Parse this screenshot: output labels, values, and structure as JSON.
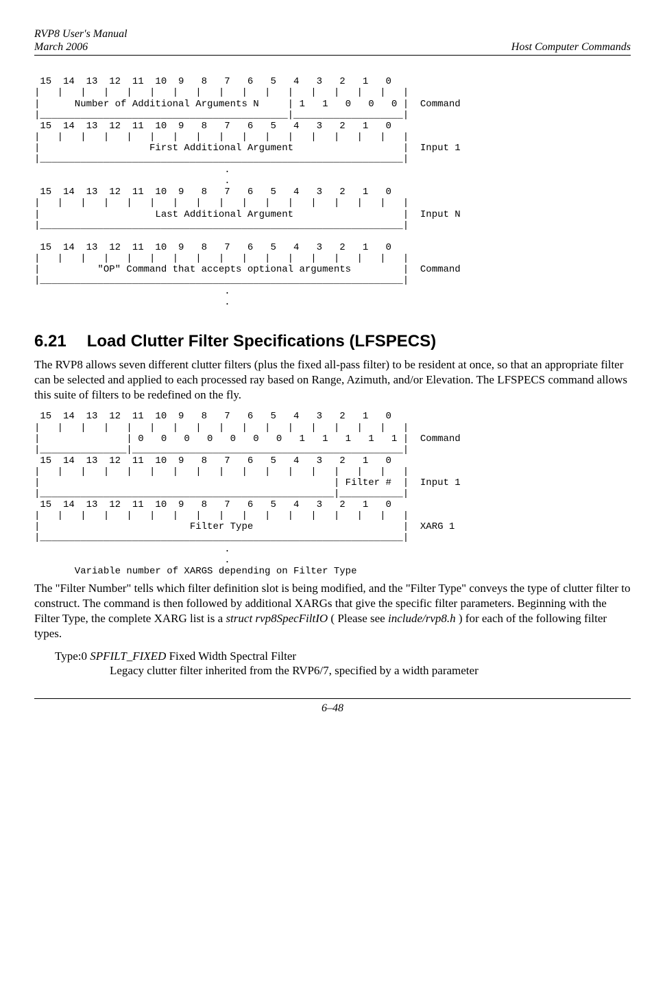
{
  "header": {
    "title": "RVP8 User's Manual",
    "date": "March 2006",
    "right": "Host Computer Commands"
  },
  "diagram1": " 15  14  13  12  11  10  9   8   7   6   5   4   3   2   1   0 \n|   |   |   |   |   |   |   |   |   |   |   |   |   |   |   |   |\n|      Number of Additional Arguments N     | 1   1   0   0   0 |  Command\n|___________________________________________|___________________|\n 15  14  13  12  11  10  9   8   7   6   5   4   3   2   1   0 \n|   |   |   |   |   |   |   |   |   |   |   |   |   |   |   |   |\n|                   First Additional Argument                   |  Input 1\n|_______________________________________________________________|\n                                 .\n                                 .\n 15  14  13  12  11  10  9   8   7   6   5   4   3   2   1   0 \n|   |   |   |   |   |   |   |   |   |   |   |   |   |   |   |   |\n|                    Last Additional Argument                   |  Input N\n|_______________________________________________________________|\n\n 15  14  13  12  11  10  9   8   7   6   5   4   3   2   1   0 \n|   |   |   |   |   |   |   |   |   |   |   |   |   |   |   |   |\n|          \"OP\" Command that accepts optional arguments         |  Command\n|_______________________________________________________________|\n                                 .\n                                 .",
  "section": {
    "num": "6.21",
    "title": "Load Clutter Filter Specifications (LFSPECS)"
  },
  "para1": "The RVP8 allows seven different clutter filters (plus the fixed all-pass filter) to be resident at once, so that an appropriate filter can be selected and applied to each processed ray based on Range, Azimuth, and/or Elevation.  The LFSPECS command allows this suite of filters to be redefined on the fly.",
  "diagram2": " 15  14  13  12  11  10  9   8   7   6   5   4   3   2   1   0 \n|   |   |   |   |   |   |   |   |   |   |   |   |   |   |   |   |\n|               | 0   0   0   0   0   0   0   1   1   1   1   1 |  Command\n|_______________|_______________________________________________|\n 15  14  13  12  11  10  9   8   7   6   5   4   3   2   1   0 \n|   |   |   |   |   |   |   |   |   |   |   |   |   |   |   |   |\n|                                                   | Filter #  |  Input 1\n|___________________________________________________|___________|\n 15  14  13  12  11  10  9   8   7   6   5   4   3   2   1   0 \n|   |   |   |   |   |   |   |   |   |   |   |   |   |   |   |   |\n|                          Filter Type                          |  XARG 1\n|_______________________________________________________________|\n                                 .\n                                 .\n       Variable number of XARGS depending on Filter Type",
  "para2a": "The \"Filter Number\" tells which filter definition slot is being modified, and the \"Filter Type\" conveys the type of clutter filter to construct.  The command is then followed by additional XARGs that give the specific filter parameters.  Beginning with the Filter Type, the complete XARG list is a  ",
  "para2b": "struct rvp8SpecFiltIO",
  "para2c": " ( Please see ",
  "para2d": "include/rvp8.h",
  "para2e": " ) for each of the following filter types.",
  "type0a": "Type:0  ",
  "type0b": "SPFILT_FIXED",
  "type0c": "  Fixed Width Spectral Filter",
  "type0desc": "Legacy clutter filter inherited from the RVP6/7, specified by a width parameter",
  "footer": {
    "page": "6–48"
  }
}
